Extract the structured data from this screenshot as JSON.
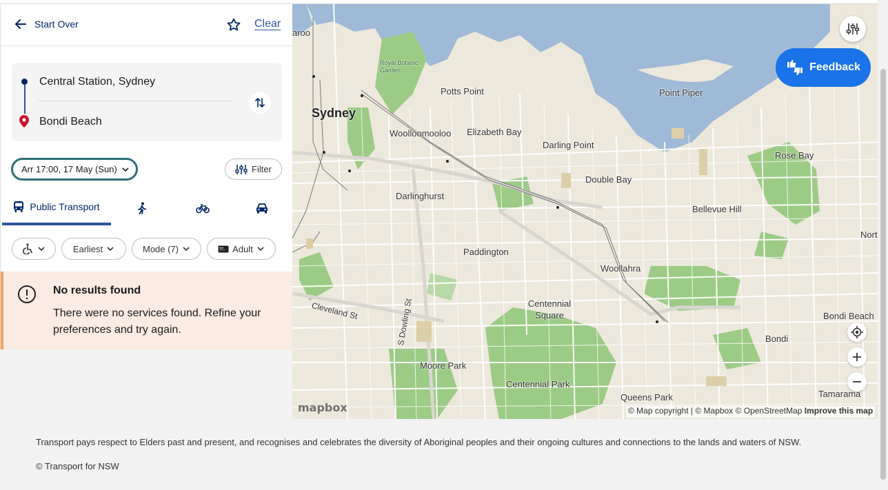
{
  "header": {
    "start_over": "Start Over",
    "clear": "Clear"
  },
  "trip": {
    "from": "Central Station, Sydney",
    "to": "Bondi Beach"
  },
  "options": {
    "datetime": "Arr 17:00, 17 May (Sun)",
    "filter": "Filter"
  },
  "tabs": {
    "public_transport": "Public Transport",
    "active": "public_transport"
  },
  "chips": {
    "earliest": "Earliest",
    "mode": "Mode (7)",
    "fare": "Adult"
  },
  "alert": {
    "title": "No results found",
    "body": "There were no services found. Refine your preferences and try again."
  },
  "map": {
    "labels": {
      "sydney": "Sydney",
      "potts_point": "Potts Point",
      "elizabeth_bay": "Elizabeth Bay",
      "woolloomooloo": "Woolloomooloo",
      "darling_point": "Darling Point",
      "point_piper": "Point Piper",
      "rose_bay": "Rose Bay",
      "double_bay": "Double Bay",
      "darlinghurst": "Darlinghurst",
      "bellevue_hill": "Bellevue Hill",
      "paddington": "Paddington",
      "woollahra": "Woollahra",
      "centennial_square": "Centennial Square",
      "cleveland_st": "Cleveland St",
      "s_dowling_st": "S Dowling St",
      "moore_park": "Moore Park",
      "centennial_park": "Centennial Park",
      "queens_park": "Queens Park",
      "bondi": "Bondi",
      "bondi_beach": "Bondi Beach",
      "tamarama": "Tamarama",
      "royal_botanic_garden": "Royal Botanic Garden",
      "north": "Nort",
      "barangaroo": "aroo"
    },
    "attribution": {
      "copyright": "© Map copyright",
      "mapbox": "© Mapbox",
      "osm": "© OpenStreetMap",
      "improve": "Improve this map"
    },
    "logo": "mapbox"
  },
  "feedback": "Feedback",
  "footer": {
    "acknowledgement": "Transport pays respect to Elders past and present, and recognises and celebrates the diversity of Aboriginal peoples and their ongoing cultures and connections to the lands and waters of NSW.",
    "copyright": "© Transport for NSW"
  },
  "colors": {
    "brand_navy": "#002664",
    "accent_blue": "#2e5299",
    "feedback_blue": "#1a73e8",
    "alert_bg": "#faebe3",
    "alert_border": "#f2a15f",
    "water": "#9fbad6",
    "park": "#9ccb86",
    "land": "#ece8dc"
  }
}
